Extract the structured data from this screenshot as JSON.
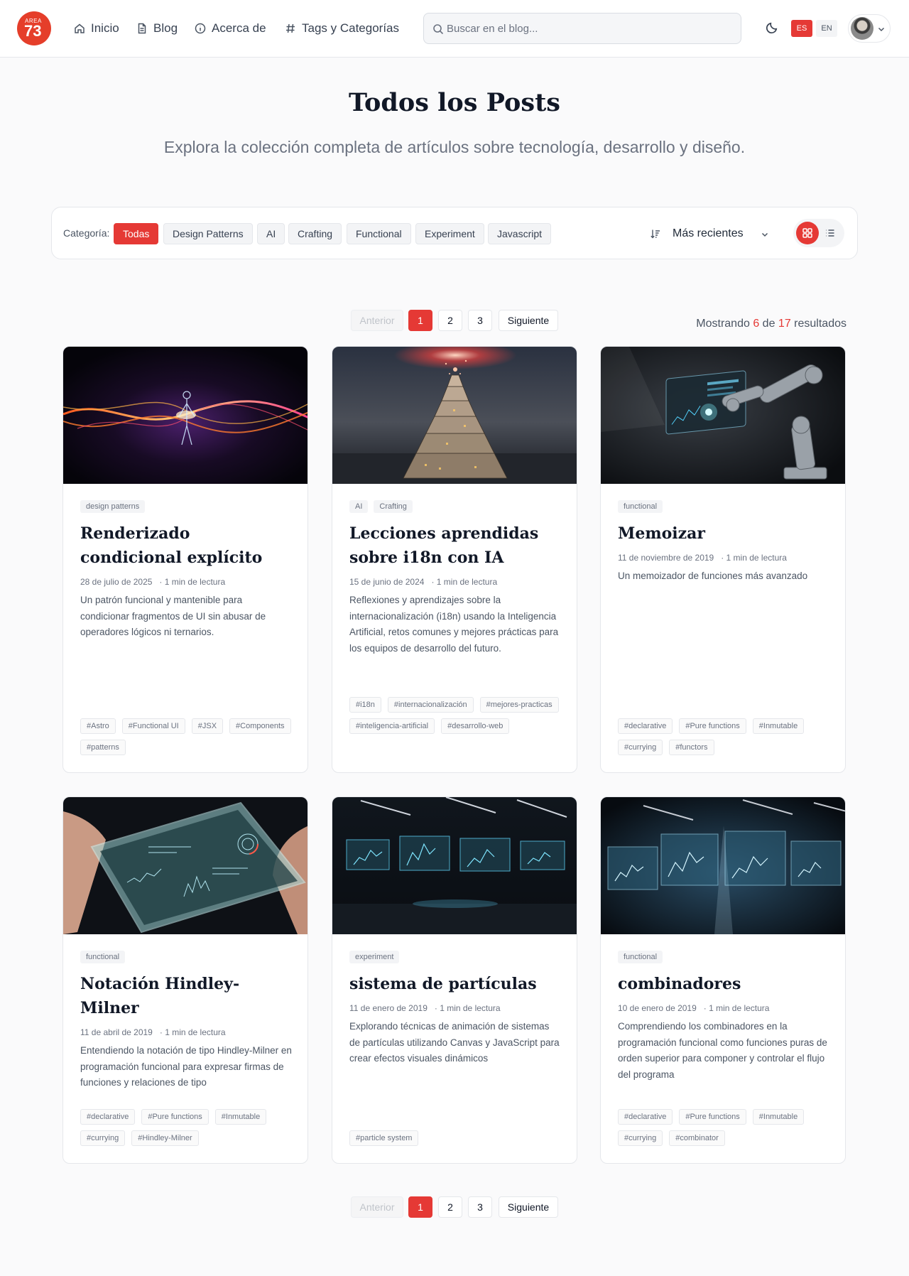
{
  "header": {
    "logo_small": "AREA",
    "logo_big": "73",
    "nav": [
      {
        "label": "Inicio",
        "icon": "home-icon"
      },
      {
        "label": "Blog",
        "icon": "document-icon"
      },
      {
        "label": "Acerca de",
        "icon": "info-icon"
      },
      {
        "label": "Tags y Categorías",
        "icon": "hash-icon"
      }
    ],
    "search_placeholder": "Buscar en el blog...",
    "lang_es": "ES",
    "lang_en": "EN"
  },
  "page": {
    "title": "Todos los Posts",
    "subtitle": "Explora la colección completa de artículos sobre tecnología, desarrollo y diseño."
  },
  "filters": {
    "category_label": "Categoría:",
    "categories": [
      "Todas",
      "Design Patterns",
      "AI",
      "Crafting",
      "Functional",
      "Experiment",
      "Javascript"
    ],
    "active_category": "Todas",
    "sort_label": "Más recientes"
  },
  "pagination": {
    "prev": "Anterior",
    "pages": [
      "1",
      "2",
      "3"
    ],
    "current": "1",
    "next": "Siguiente"
  },
  "results": {
    "prefix": "Mostrando",
    "shown": "6",
    "middle": "de",
    "total": "17",
    "suffix": "resultados"
  },
  "posts": [
    {
      "categories": [
        "design patterns"
      ],
      "title": "Renderizado condicional explícito",
      "date": "28 de julio de 2025",
      "read": "· 1 min de lectura",
      "description": "Un patrón funcional y mantenible para condicionar fragmentos de UI sin abusar de operadores lógicos ni ternarios.",
      "tags": [
        "#Astro",
        "#Functional UI",
        "#JSX",
        "#Components",
        "#patterns"
      ],
      "image": "energy-figure"
    },
    {
      "categories": [
        "AI",
        "Crafting"
      ],
      "title": "Lecciones aprendidas sobre i18n con IA",
      "date": "15 de junio de 2024",
      "read": "· 1 min de lectura",
      "description": "Reflexiones y aprendizajes sobre la internacionalización (i18n) usando la Inteligencia Artificial, retos comunes y mejores prácticas para los equipos de desarrollo del futuro.",
      "tags": [
        "#i18n",
        "#internacionalización",
        "#mejores-practicas",
        "#inteligencia-artificial",
        "#desarrollo-web"
      ],
      "image": "babel-tower"
    },
    {
      "categories": [
        "functional"
      ],
      "title": "Memoizar",
      "date": "11 de noviembre de 2019",
      "read": "· 1 min de lectura",
      "description": "Un memoizador de funciones más avanzado",
      "tags": [
        "#declarative",
        "#Pure functions",
        "#Inmutable",
        "#currying",
        "#functors"
      ],
      "image": "robot-arm"
    },
    {
      "categories": [
        "functional"
      ],
      "title": "Notación Hindley-Milner",
      "date": "11 de abril de 2019",
      "read": "· 1 min de lectura",
      "description": "Entendiendo la notación de tipo Hindley-Milner en programación funcional para expresar firmas de funciones y relaciones de tipo",
      "tags": [
        "#declarative",
        "#Pure functions",
        "#Inmutable",
        "#currying",
        "#Hindley-Milner"
      ],
      "image": "glass-tablet"
    },
    {
      "categories": [
        "experiment"
      ],
      "title": "sistema de partículas",
      "date": "11 de enero de 2019",
      "read": "· 1 min de lectura",
      "description": "Explorando técnicas de animación de sistemas de partículas utilizando Canvas y JavaScript para crear efectos visuales dinámicos",
      "tags": [
        "#particle system"
      ],
      "image": "data-screens"
    },
    {
      "categories": [
        "functional"
      ],
      "title": "combinadores",
      "date": "10 de enero de 2019",
      "read": "· 1 min de lectura",
      "description": "Comprendiendo los combinadores en la programación funcional como funciones puras de orden superior para componer y controlar el flujo del programa",
      "tags": [
        "#declarative",
        "#Pure functions",
        "#Inmutable",
        "#currying",
        "#combinator"
      ],
      "image": "holo-panels"
    }
  ]
}
